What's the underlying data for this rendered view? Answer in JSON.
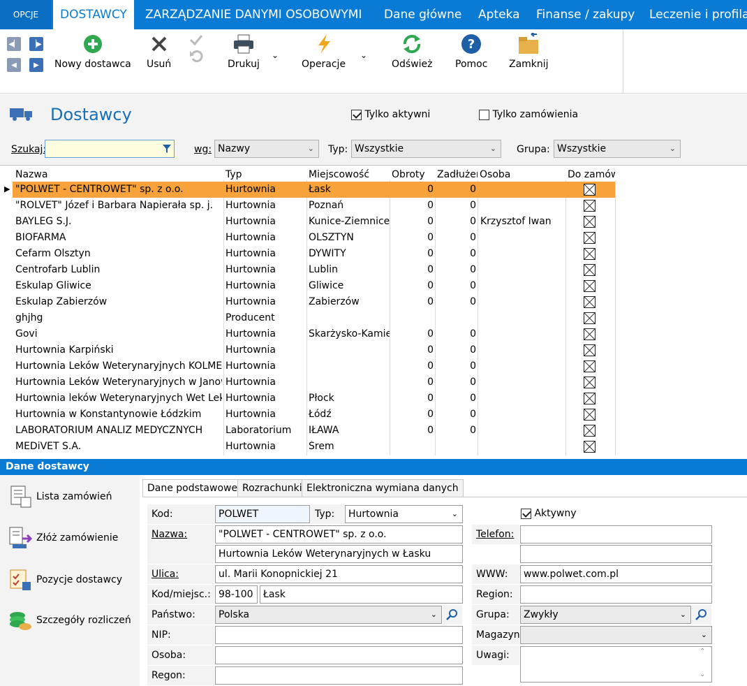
{
  "top_tabs": {
    "opcje": "OPCJE",
    "items": [
      "DOSTAWCY",
      "ZARZĄDZANIE DANYMI OSOBOWYMI",
      "Dane główne",
      "Apteka",
      "Finanse / zakupy",
      "Leczenie i profilak"
    ]
  },
  "ribbon": {
    "new_supplier": "Nowy dostawca",
    "delete": "Usuń",
    "print": "Drukuj",
    "operations": "Operacje",
    "refresh": "Odśwież",
    "help": "Pomoc",
    "close": "Zamknij"
  },
  "header": {
    "title": "Dostawcy",
    "only_active_label": "Tylko aktywni",
    "only_active_checked": true,
    "only_orders_label": "Tylko zamówienia",
    "only_orders_checked": false
  },
  "filters": {
    "search_label": "Szukaj:",
    "search_value": "",
    "by_label": "wg:",
    "by_value": "Nazwy",
    "type_label": "Typ:",
    "type_value": "Wszystkie",
    "group_label": "Grupa:",
    "group_value": "Wszystkie"
  },
  "grid": {
    "columns": [
      "Nazwa",
      "Typ",
      "Miejscowość",
      "Obroty",
      "Zadłużer",
      "Osoba",
      "Do zamów"
    ],
    "rows": [
      {
        "name": "\"POLWET - CENTROWET\"  sp. z o.o.",
        "type": "Hurtownia",
        "city": "Łask",
        "turnover": "0",
        "debt": "0",
        "person": ""
      },
      {
        "name": "\"ROLVET\" Józef i Barbara Napierała sp. j.",
        "type": "Hurtownia",
        "city": "Poznań",
        "turnover": "0",
        "debt": "0",
        "person": ""
      },
      {
        "name": "BAYLEG S.J.",
        "type": "Hurtownia",
        "city": "Kunice-Ziemnice",
        "turnover": "0",
        "debt": "0",
        "person": "Krzysztof Iwan"
      },
      {
        "name": "BIOFARMA",
        "type": "Hurtownia",
        "city": "OLSZTYN",
        "turnover": "0",
        "debt": "0",
        "person": ""
      },
      {
        "name": "Cefarm Olsztyn",
        "type": "Hurtownia",
        "city": "DYWITY",
        "turnover": "0",
        "debt": "0",
        "person": ""
      },
      {
        "name": "Centrofarb Lublin",
        "type": "Hurtownia",
        "city": "Lublin",
        "turnover": "0",
        "debt": "0",
        "person": ""
      },
      {
        "name": "Eskulap Gliwice",
        "type": "Hurtownia",
        "city": "Gliwice",
        "turnover": "0",
        "debt": "0",
        "person": ""
      },
      {
        "name": "Eskulap Zabierzów",
        "type": "Hurtownia",
        "city": "Zabierzów",
        "turnover": "0",
        "debt": "0",
        "person": ""
      },
      {
        "name": "ghjhg",
        "type": "Producent",
        "city": "",
        "turnover": "",
        "debt": "",
        "person": ""
      },
      {
        "name": "Govi",
        "type": "Hurtownia",
        "city": "Skarżysko-Kamienna",
        "turnover": "0",
        "debt": "0",
        "person": ""
      },
      {
        "name": "Hurtownia Karpiński",
        "type": "Hurtownia",
        "city": "",
        "turnover": "0",
        "debt": "0",
        "person": ""
      },
      {
        "name": "Hurtownia Leków Weterynaryjnych KOLME",
        "type": "Hurtownia",
        "city": "",
        "turnover": "0",
        "debt": "0",
        "person": ""
      },
      {
        "name": "Hurtownia Leków Weterynaryjnych w Janowcu",
        "type": "Hurtownia",
        "city": "",
        "turnover": "0",
        "debt": "0",
        "person": ""
      },
      {
        "name": "Hurtownia leków Weterynaryjnych Wet Lek",
        "type": "Hurtownia",
        "city": "Płock",
        "turnover": "0",
        "debt": "0",
        "person": ""
      },
      {
        "name": "Hurtownia w Konstantynowie Łódzkim",
        "type": "Hurtownia",
        "city": "Łódź",
        "turnover": "0",
        "debt": "0",
        "person": ""
      },
      {
        "name": "LABORATORIUM  ANALIZ  MEDYCZNYCH",
        "type": "Laboratorium",
        "city": "IŁAWA",
        "turnover": "0",
        "debt": "0",
        "person": ""
      },
      {
        "name": "MEDiVET S.A.",
        "type": "Hurtownia",
        "city": "Śrem",
        "turnover": "",
        "debt": "",
        "person": ""
      }
    ]
  },
  "details": {
    "section_title": "Dane dostawcy",
    "side_actions": [
      "Lista zamówień",
      "Złóż zamówienie",
      "Pozycje dostawcy",
      "Szczegóły rozliczeń"
    ],
    "tabs": [
      "Dane podstawowe",
      "Rozrachunki",
      "Elektroniczna wymiana danych"
    ],
    "labels": {
      "kod": "Kod:",
      "typ": "Typ:",
      "nazwa": "Nazwa:",
      "ulica": "Ulica:",
      "kod_miejsc": "Kod/miejsc.:",
      "panstwo": "Państwo:",
      "nip": "NIP:",
      "osoba": "Osoba:",
      "regon": "Regon:",
      "aktywny": "Aktywny",
      "telefon": "Telefon:",
      "www": "WWW:",
      "region": "Region:",
      "grupa": "Grupa:",
      "magazyn": "Magazyn:",
      "uwagi": "Uwagi:"
    },
    "values": {
      "kod": "POLWET",
      "typ": "Hurtownia",
      "nazwa1": "\"POLWET - CENTROWET\"  sp. z o.o.",
      "nazwa2": "Hurtownia Leków Weterynaryjnych w Łasku",
      "ulica": "ul. Marii Konopnickiej 21",
      "kod_pocztowy": "98-100",
      "miejscowosc": "Łask",
      "panstwo": "Polska",
      "nip": "",
      "osoba": "",
      "regon": "",
      "aktywny": true,
      "telefon1": "",
      "telefon2": "",
      "www": "www.polwet.com.pl",
      "region": "",
      "grupa": "Zwykły",
      "magazyn": "",
      "uwagi": ""
    }
  },
  "colors": {
    "accent": "#0a7bd4",
    "selected_row": "#f7a23a",
    "title": "#1a6fb5"
  }
}
